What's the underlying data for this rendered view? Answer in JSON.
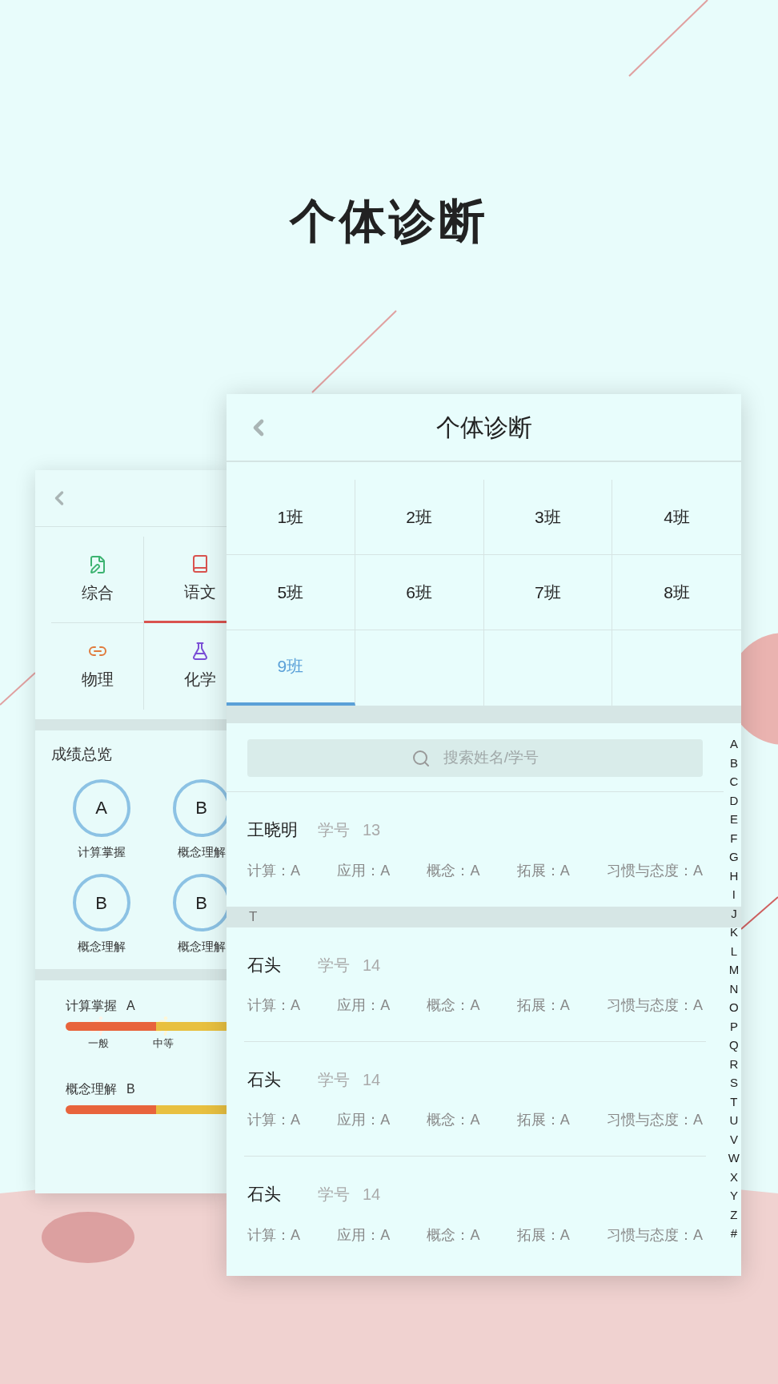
{
  "poster_title": "个体诊断",
  "back_window": {
    "subjects": [
      {
        "label": "综合",
        "selected": false
      },
      {
        "label": "语文",
        "selected": true
      },
      {
        "label": "物理",
        "selected": false
      },
      {
        "label": "化学",
        "selected": false
      }
    ],
    "overview": {
      "title": "成绩总览",
      "grades": [
        {
          "grade": "A",
          "label": "计算掌握"
        },
        {
          "grade": "B",
          "label": "概念理解"
        },
        {
          "grade": "B",
          "label": "概念理解"
        },
        {
          "grade": "B",
          "label": "概念理解"
        }
      ]
    },
    "progress": [
      {
        "title": "计算掌握",
        "grade": "A",
        "marks": [
          "一般",
          "中等"
        ]
      },
      {
        "title": "概念理解",
        "grade": "B"
      }
    ]
  },
  "front_window": {
    "title": "个体诊断",
    "classes": [
      {
        "label": "1班",
        "selected": false
      },
      {
        "label": "2班",
        "selected": false
      },
      {
        "label": "3班",
        "selected": false
      },
      {
        "label": "4班",
        "selected": false
      },
      {
        "label": "5班",
        "selected": false
      },
      {
        "label": "6班",
        "selected": false
      },
      {
        "label": "7班",
        "selected": false
      },
      {
        "label": "8班",
        "selected": false
      },
      {
        "label": "9班",
        "selected": true
      }
    ],
    "search": {
      "placeholder": "搜索姓名/学号"
    },
    "list": [
      {
        "kind": "student",
        "name": "王晓明",
        "id_label": "学号",
        "id": "13",
        "scores": [
          "计算：A",
          "应用：A",
          "概念：A",
          "拓展：A",
          "习惯与态度：A"
        ]
      },
      {
        "kind": "header",
        "label": "T"
      },
      {
        "kind": "student",
        "name": "石头",
        "id_label": "学号",
        "id": "14",
        "scores": [
          "计算：A",
          "应用：A",
          "概念：A",
          "拓展：A",
          "习惯与态度：A"
        ]
      },
      {
        "kind": "student",
        "name": "石头",
        "id_label": "学号",
        "id": "14",
        "scores": [
          "计算：A",
          "应用：A",
          "概念：A",
          "拓展：A",
          "习惯与态度：A"
        ]
      },
      {
        "kind": "student",
        "name": "石头",
        "id_label": "学号",
        "id": "14",
        "scores": [
          "计算：A",
          "应用：A",
          "概念：A",
          "拓展：A",
          "习惯与态度：A"
        ]
      }
    ],
    "index": [
      "A",
      "B",
      "C",
      "D",
      "E",
      "F",
      "G",
      "H",
      "I",
      "J",
      "K",
      "L",
      "M",
      "N",
      "O",
      "P",
      "Q",
      "R",
      "S",
      "T",
      "U",
      "V",
      "W",
      "X",
      "Y",
      "Z",
      "#"
    ]
  }
}
